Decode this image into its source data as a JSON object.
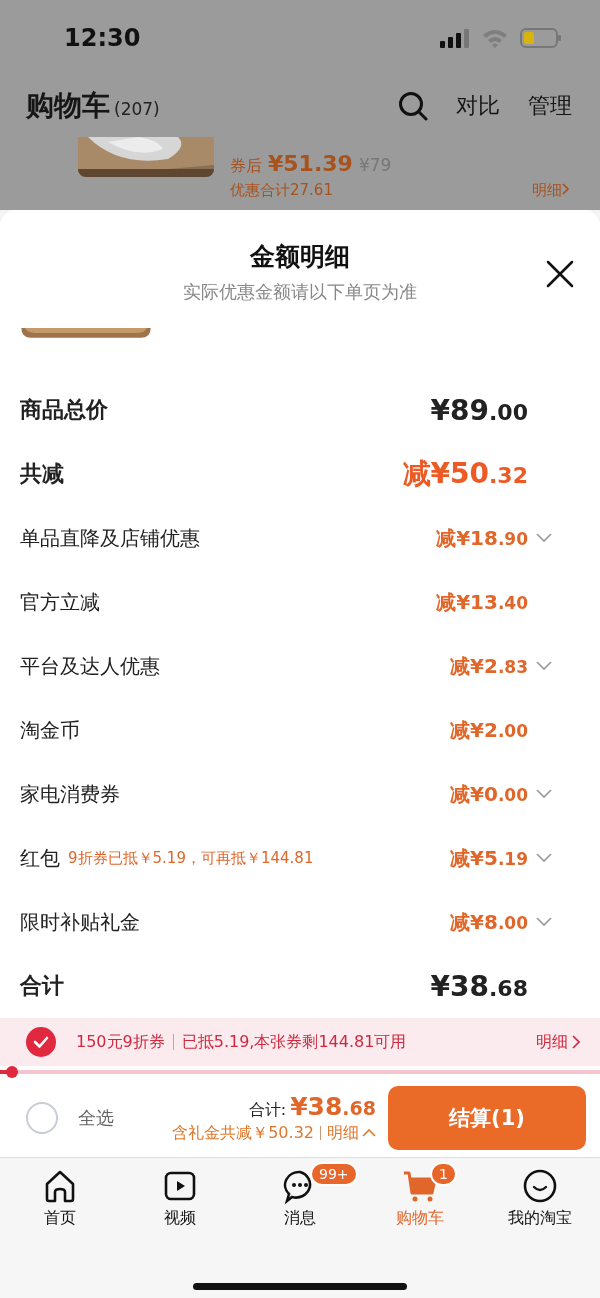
{
  "status_bar": {
    "time": "12:30"
  },
  "header": {
    "title": "购物车",
    "count": "(207)",
    "actions": [
      "对比",
      "管理"
    ]
  },
  "background_item": {
    "price_label": "券后",
    "price": "¥51.39",
    "original_price": "¥79",
    "discount_total": "优惠合计27.61",
    "details_link": "明细"
  },
  "sheet": {
    "title": "金额明细",
    "subtitle": "实际优惠金额请以下单页为准",
    "rows": [
      {
        "kind": "total",
        "label": "商品总价",
        "value": "¥89.00"
      },
      {
        "kind": "discount_total",
        "label": "共减",
        "value": "减¥50.32"
      },
      {
        "kind": "item",
        "label": "单品直降及店铺优惠",
        "value": "减¥18.90",
        "expandable": true
      },
      {
        "kind": "item",
        "label": "官方立减",
        "value": "减¥13.40",
        "expandable": false
      },
      {
        "kind": "item",
        "label": "平台及达人优惠",
        "value": "减¥2.83",
        "expandable": true
      },
      {
        "kind": "item",
        "label": "淘金币",
        "value": "减¥2.00",
        "expandable": false
      },
      {
        "kind": "item",
        "label": "家电消费券",
        "value": "减¥0.00",
        "expandable": true
      },
      {
        "kind": "item",
        "label": "红包",
        "note": "9折券已抵￥5.19，可再抵￥144.81",
        "value": "减¥5.19",
        "expandable": true
      },
      {
        "kind": "item",
        "label": "限时补贴礼金",
        "value": "减¥8.00",
        "expandable": true
      },
      {
        "kind": "total",
        "label": "合计",
        "value": "¥38.68"
      }
    ]
  },
  "coupon_bar": {
    "checked": true,
    "coupon": "150元9折券",
    "info": "已抵5.19,本张券剩144.81可用",
    "link": "明细",
    "level": 0.02
  },
  "checkout_bar": {
    "select_all": {
      "label": "全选",
      "checked": false
    },
    "total_label": "合计:",
    "total": "¥38.68",
    "savings": "含礼金共减￥50.32",
    "details_link": "明细",
    "button": "结算(1)"
  },
  "tab_bar": [
    {
      "kind": "home",
      "label": "首页",
      "selected": false
    },
    {
      "kind": "video",
      "label": "视频",
      "selected": false
    },
    {
      "kind": "message",
      "label": "消息",
      "badge": "99+",
      "selected": false
    },
    {
      "kind": "cart",
      "label": "购物车",
      "badge": "1",
      "selected": true
    },
    {
      "kind": "profile",
      "label": "我的淘宝",
      "selected": false
    }
  ]
}
